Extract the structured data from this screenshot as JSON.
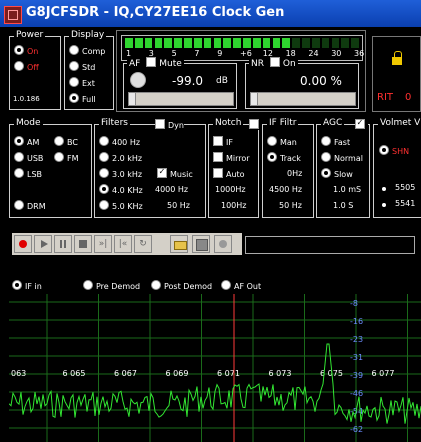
{
  "window": {
    "title": "G8JCFSDR - IQ,CY27EE16 Clock Gen"
  },
  "power": {
    "label": "Power",
    "options": [
      "On",
      "Off"
    ],
    "selected": "On",
    "version": "1.0.186"
  },
  "display": {
    "label": "Display",
    "options": [
      "Comp",
      "Std",
      "Ext",
      "Full"
    ],
    "selected": "Full"
  },
  "meter": {
    "scale": [
      "1",
      "3",
      "5",
      "7",
      "9",
      "+6",
      "12",
      "18",
      "24",
      "30",
      "36"
    ],
    "level_fraction": 0.7
  },
  "af": {
    "label": "AF",
    "mute_label": "Mute",
    "value": "-99.0",
    "unit": "dB"
  },
  "nr": {
    "label": "NR",
    "on_label": "On",
    "value": "0.00 %"
  },
  "rit": {
    "label": "RIT",
    "value": "0"
  },
  "mode": {
    "label": "Mode",
    "options": [
      "AM",
      "BC",
      "USB",
      "FM",
      "LSB",
      "DRM"
    ],
    "selected": "AM"
  },
  "filters": {
    "label": "Filters",
    "dyn_label": "Dyn",
    "options": [
      "400 Hz",
      "2.0 kHz",
      "3.0 kHz",
      "4.0 KHz",
      "5.0 KHz"
    ],
    "selected": "4.0 KHz",
    "music_label": "Music",
    "values": [
      "4000 Hz",
      "50 Hz"
    ]
  },
  "notch": {
    "label": "Notch",
    "options": [
      "IF",
      "Mirror",
      "Auto"
    ],
    "values": [
      "1000Hz",
      "100Hz"
    ]
  },
  "if_filtr": {
    "label": "IF Filtr",
    "options": [
      "Man",
      "Track"
    ],
    "selected": "Track",
    "values": [
      "0Hz",
      "4500 Hz",
      "50 Hz"
    ]
  },
  "agc": {
    "label": "AGC",
    "options": [
      "Fast",
      "Normal",
      "Slow"
    ],
    "selected": "Slow",
    "values": [
      "1.0 mS",
      "1.0 S"
    ]
  },
  "volmet": {
    "label": "Volmet V",
    "items": [
      "SHN",
      "5505",
      "5541"
    ],
    "selected": "SHN"
  },
  "spectrum": {
    "options": [
      "IF in",
      "Pre Demod",
      "Post Demod",
      "AF Out"
    ],
    "selected": "IF in",
    "freq_labels": [
      "063",
      "6 065",
      "6 067",
      "6 069",
      "6 071",
      "6 073",
      "6 075",
      "6 077"
    ],
    "db_labels": [
      "-8",
      "-16",
      "-23",
      "-31",
      "-39",
      "-46",
      "-54",
      "-62"
    ],
    "colors": {
      "trace": "#32e632",
      "grid": "#1a6a1a",
      "marker": "#ff3a3a",
      "db_text": "#6c8cff"
    }
  }
}
